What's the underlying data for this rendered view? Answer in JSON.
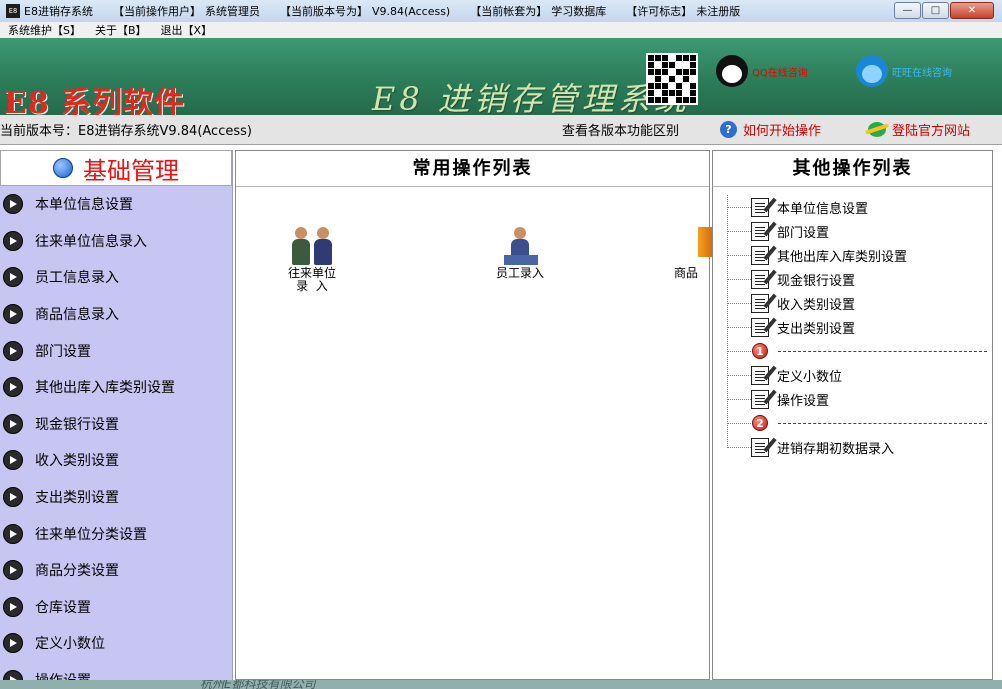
{
  "titlebar": {
    "app_name": "E8进销存系统",
    "user_label": "【当前操作用户】",
    "user_value": "系统管理员",
    "version_label": "【当前版本号为】",
    "version_value": "V9.84(Access)",
    "account_label": "【当前帐套为】",
    "account_value": "学习数据库",
    "license_label": "【许可标志】",
    "license_value": "未注册版",
    "minimize": "—",
    "maximize": "□",
    "close": "✕"
  },
  "menu": {
    "items": [
      {
        "label": "系统维护【S】"
      },
      {
        "label": "关于【B】"
      },
      {
        "label": "退出【X】"
      }
    ]
  },
  "banner": {
    "brand": "E8 系列软件",
    "title": "E8 进销存管理系统",
    "qq_online": "QQ在线咨询",
    "wangwang_online": "旺旺在线咨询"
  },
  "status": {
    "version_text": "当前版本号：E8进销存系统V9.84(Access)",
    "compare_text": "查看各版本功能区别",
    "how_text": "如何开始操作",
    "site_text": "登陆官方网站"
  },
  "left": {
    "header": "基础管理",
    "items": [
      "本单位信息设置",
      "往来单位信息录入",
      "员工信息录入",
      "商品信息录入",
      "部门设置",
      "其他出库入库类别设置",
      "现金银行设置",
      "收入类别设置",
      "支出类别设置",
      "往来单位分类设置",
      "商品分类设置",
      "仓库设置",
      "定义小数位",
      "操作设置"
    ]
  },
  "center": {
    "title": "常用操作列表",
    "ops": [
      {
        "label": "往来单位\n录  入"
      },
      {
        "label": "员工录入"
      },
      {
        "label": "商品"
      }
    ]
  },
  "right": {
    "title": "其他操作列表",
    "tree": [
      {
        "type": "item",
        "label": "本单位信息设置"
      },
      {
        "type": "item",
        "label": "部门设置"
      },
      {
        "type": "item",
        "label": "其他出库入库类别设置"
      },
      {
        "type": "item",
        "label": "现金银行设置"
      },
      {
        "type": "item",
        "label": "收入类别设置"
      },
      {
        "type": "item",
        "label": "支出类别设置"
      },
      {
        "type": "group",
        "num": "1"
      },
      {
        "type": "item",
        "label": "定义小数位"
      },
      {
        "type": "item",
        "label": "操作设置"
      },
      {
        "type": "group",
        "num": "2"
      },
      {
        "type": "item",
        "label": "进销存期初数据录入"
      }
    ]
  },
  "footer": {
    "text": "杭州E都科技有限公司"
  }
}
